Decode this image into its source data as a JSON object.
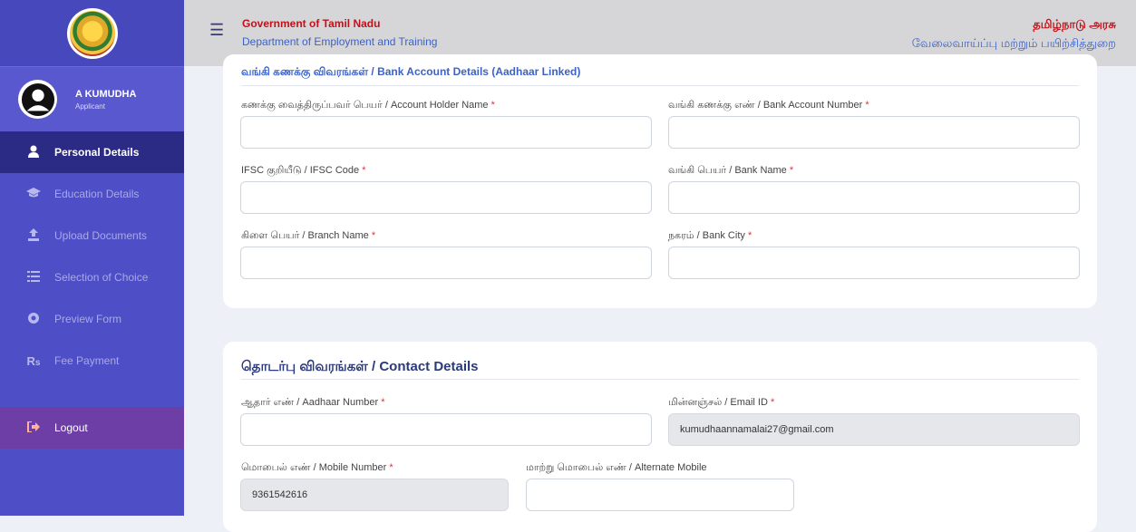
{
  "header": {
    "gov_en": "Government of Tamil Nadu",
    "dept_en": "Department of Employment and Training",
    "gov_ta": "தமிழ்நாடு அரசு",
    "dept_ta": "வேலைவாய்ப்பு மற்றும் பயிற்சித்துறை"
  },
  "profile": {
    "name": "A KUMUDHA",
    "role": "Applicant"
  },
  "sidebar": {
    "items": [
      {
        "label": "Personal Details",
        "icon": "user-icon"
      },
      {
        "label": "Education Details",
        "icon": "graduation-cap-icon"
      },
      {
        "label": "Upload Documents",
        "icon": "upload-icon"
      },
      {
        "label": "Selection of Choice",
        "icon": "list-icon"
      },
      {
        "label": "Preview Form",
        "icon": "eye-icon"
      },
      {
        "label": "Fee Payment",
        "icon": "rupee-icon"
      }
    ],
    "logout": "Logout"
  },
  "bank": {
    "title": "வங்கி கணக்கு விவரங்கள் / Bank Account Details (Aadhaar Linked)",
    "holder_label": "கணக்கு வைத்திருப்பவர் பெயர் / Account Holder Name",
    "account_label": "வங்கி கணக்கு எண் / Bank Account Number",
    "ifsc_label": "IFSC குறியீடு / IFSC Code",
    "bankname_label": "வங்கி பெயர் / Bank Name",
    "branch_label": "கிளை பெயர் / Branch Name",
    "city_label": "நகரம் / Bank City",
    "holder_value": "",
    "account_value": "",
    "ifsc_value": "",
    "bankname_value": "",
    "branch_value": "",
    "city_value": ""
  },
  "contact": {
    "title": "தொடர்பு விவரங்கள் / Contact Details",
    "aadhaar_label": "ஆதார் எண் / Aadhaar Number",
    "email_label": "மின்னஞ்சல் / Email ID",
    "mobile_label": "மொபைல் எண் / Mobile Number",
    "alt_mobile_label": "மாற்று மொபைல் எண் / Alternate Mobile",
    "aadhaar_value": "",
    "email_value": "kumudhaannamalai27@gmail.com",
    "mobile_value": "9361542616",
    "alt_mobile_value": ""
  },
  "required_mark": "*",
  "colors": {
    "sidebar": "#4e4ec7",
    "active_nav": "#2b2a85",
    "title_red": "#c0121a",
    "link_blue": "#3a62c9"
  }
}
